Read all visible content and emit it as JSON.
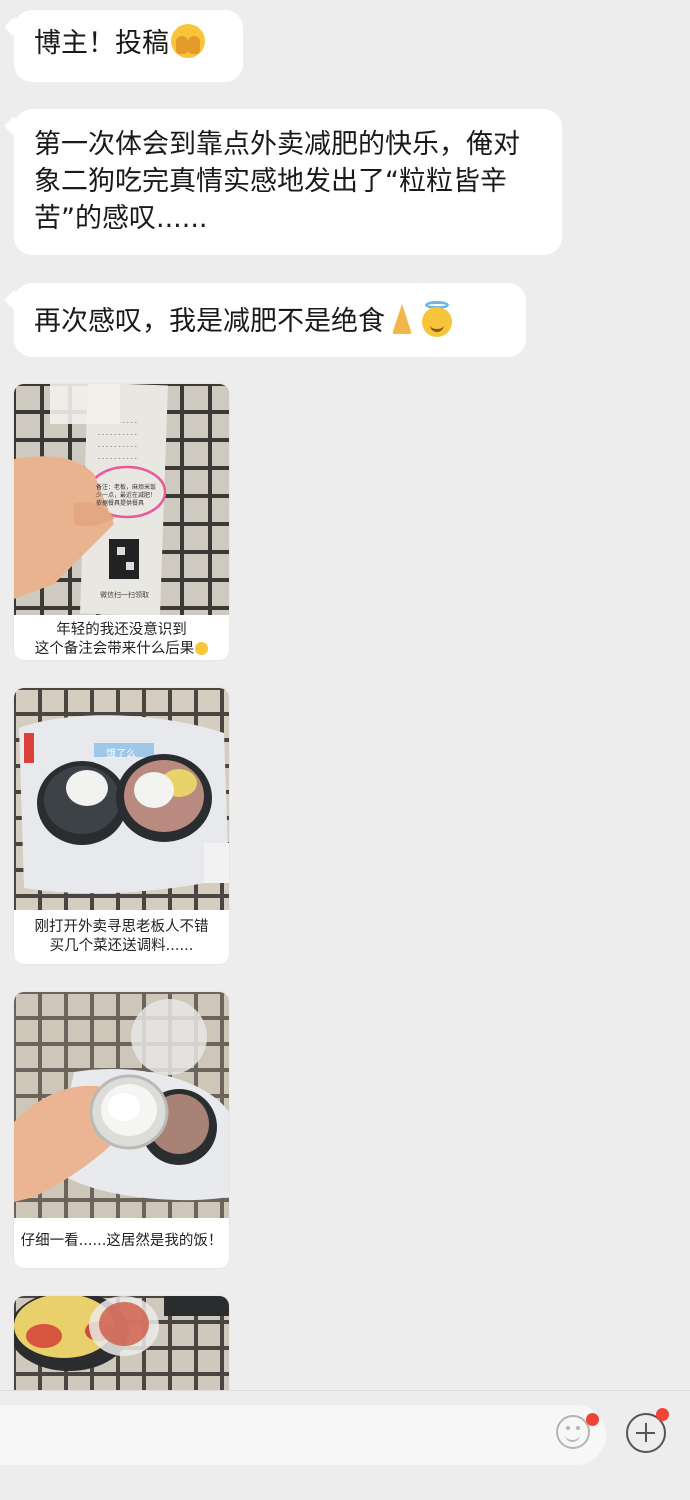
{
  "messages": [
    {
      "text": "博主！投稿",
      "emoji": "face-with-hand-over-mouth"
    },
    {
      "text": "第一次体会到靠点外卖减肥的快乐，俺对象二狗吃完真情实感地发出了“粒粒皆辛苦”的感叹......"
    },
    {
      "text": "再次感叹，我是减肥不是绝食",
      "emoji": [
        "folded-hands",
        "smiling-face-with-halo"
      ]
    }
  ],
  "photos": [
    {
      "caption_line1": "年轻的我还没意识到",
      "caption_line2": "这个备注会带来什么后果",
      "receipt_note": "备注：老板，麻烦米饭少一点，最近在减肥！依据餐具提供餐具",
      "receipt_footer": "微信扫一扫领取"
    },
    {
      "caption_line1": "刚打开外卖寻思老板人不错",
      "caption_line2": "买几个菜还送调料......",
      "bag_text": "饿了么"
    },
    {
      "caption_line1": "仔细一看......这居然是我的饭！"
    },
    {}
  ],
  "input_bar": {
    "emoji_icon": "smiley-face-icon",
    "plus_icon": "plus-circle-icon"
  },
  "colors": {
    "background": "#ededed",
    "bubble": "#ffffff",
    "badge": "#f04438"
  }
}
